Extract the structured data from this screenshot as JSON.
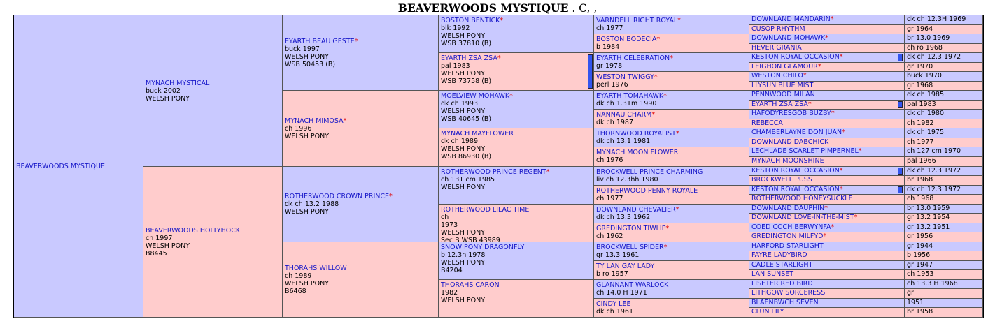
{
  "title": {
    "name": "BEAVERWOODS MYSTIQUE",
    "suffix": " . C, ,"
  },
  "subject": {
    "name": "BEAVERWOODS MYSTIQUE"
  },
  "gen1": [
    {
      "sex": "m",
      "name": "MYNACH MYSTICAL",
      "star": "",
      "lines": [
        "buck 2002",
        "WELSH PONY"
      ]
    },
    {
      "sex": "f",
      "name": "BEAVERWOODS HOLLYHOCK",
      "star": "",
      "lines": [
        "ch 1997",
        "WELSH PONY",
        "B8445"
      ]
    }
  ],
  "gen2": [
    {
      "sex": "m",
      "name": "EYARTH BEAU GESTE",
      "star": "*",
      "lines": [
        "buck 1997",
        "WELSH PONY",
        "WSB 50453 (B)"
      ]
    },
    {
      "sex": "f",
      "name": "MYNACH MIMOSA",
      "star": "*",
      "lines": [
        "ch 1996",
        "WELSH PONY"
      ]
    },
    {
      "sex": "m",
      "name": "ROTHERWOOD CROWN PRINCE",
      "star": "*",
      "lines": [
        "dk ch 13.2 1988",
        "WELSH PONY"
      ]
    },
    {
      "sex": "f",
      "name": "THORAHS WILLOW",
      "star": "",
      "lines": [
        "ch 1989",
        "WELSH PONY",
        "B6468"
      ]
    }
  ],
  "gen3": [
    {
      "sex": "m",
      "name": "BOSTON BENTICK",
      "star": "*",
      "lines": [
        "blk 1992",
        "WELSH PONY",
        "WSB 37810 (B)"
      ]
    },
    {
      "sex": "f",
      "name": "EYARTH ZSA ZSA",
      "star": "*",
      "lines": [
        "pal 1983",
        "WELSH PONY",
        "WSB 73758 (B)"
      ]
    },
    {
      "sex": "m",
      "name": "MOELVIEW MOHAWK",
      "star": "*",
      "lines": [
        "dk ch 1993",
        "WELSH PONY",
        "WSB 40645 (B)"
      ]
    },
    {
      "sex": "f",
      "name": "MYNACH MAYFLOWER",
      "star": "",
      "lines": [
        "dk ch 1989",
        "WELSH PONY",
        "WSB 86930 (B)"
      ]
    },
    {
      "sex": "m",
      "name": "ROTHERWOOD PRINCE REGENT",
      "star": "*",
      "lines": [
        "ch 131 cm 1985",
        "WELSH PONY"
      ]
    },
    {
      "sex": "f",
      "name": "ROTHERWOOD LILAC TIME",
      "star": "",
      "lines": [
        "ch",
        "1973",
        "WELSH PONY",
        "Sec B WSB 43989"
      ]
    },
    {
      "sex": "m",
      "name": "SNOW PONY DRAGONFLY",
      "star": "",
      "lines": [
        "b 12.3h 1978",
        "WELSH PONY",
        "B4204"
      ]
    },
    {
      "sex": "f",
      "name": "THORAHS CARON",
      "star": "",
      "lines": [
        "1982",
        "WELSH PONY"
      ]
    }
  ],
  "gen4": [
    {
      "sex": "m",
      "name": "VARNDELL RIGHT ROYAL",
      "star": "*",
      "lines": [
        "ch 1977"
      ]
    },
    {
      "sex": "f",
      "name": "BOSTON BODECIA",
      "star": "*",
      "lines": [
        "b 1984"
      ]
    },
    {
      "sex": "m",
      "name": "EYARTH CELEBRATION",
      "star": "*",
      "lines": [
        "gr 1978"
      ]
    },
    {
      "sex": "f",
      "name": "WESTON TWIGGY",
      "star": "*",
      "lines": [
        "perl 1976"
      ]
    },
    {
      "sex": "m",
      "name": "EYARTH TOMAHAWK",
      "star": "*",
      "lines": [
        "dk ch 1.31m 1990"
      ]
    },
    {
      "sex": "f",
      "name": "NANNAU CHARM",
      "star": "*",
      "lines": [
        "dk ch 1987"
      ]
    },
    {
      "sex": "m",
      "name": "THORNWOOD ROYALIST",
      "star": "*",
      "lines": [
        "dk ch 13.1 1981"
      ]
    },
    {
      "sex": "f",
      "name": "MYNACH MOON FLOWER",
      "star": "",
      "lines": [
        "ch 1976"
      ]
    },
    {
      "sex": "m",
      "name": "BROCKWELL PRINCE CHARMING",
      "star": "",
      "lines": [
        "liv ch 12.3hh 1980"
      ]
    },
    {
      "sex": "f",
      "name": "ROTHERWOOD PENNY ROYALE",
      "star": "",
      "lines": [
        "ch 1977"
      ]
    },
    {
      "sex": "m",
      "name": "DOWNLAND CHEVALIER",
      "star": "*",
      "lines": [
        "dk ch 13.3 1962"
      ]
    },
    {
      "sex": "f",
      "name": "GREDINGTON TIWLIP",
      "star": "*",
      "lines": [
        "ch 1962"
      ]
    },
    {
      "sex": "m",
      "name": "BROCKWELL SPIDER",
      "star": "*",
      "lines": [
        "gr 13.3 1961"
      ]
    },
    {
      "sex": "f",
      "name": "TY LAN GAY LADY",
      "star": "",
      "lines": [
        "b ro 1957"
      ]
    },
    {
      "sex": "m",
      "name": "GLANNANT WARLOCK",
      "star": "",
      "lines": [
        "ch 14.0 H 1971"
      ]
    },
    {
      "sex": "f",
      "name": "CINDY LEE",
      "star": "",
      "lines": [
        "dk ch 1961"
      ]
    }
  ],
  "gen5": [
    {
      "sex": "m",
      "name": "DOWNLAND MANDARIN",
      "star": "*",
      "info": "dk ch 12.3H 1969"
    },
    {
      "sex": "f",
      "name": "CUSOP RHYTHM",
      "star": "",
      "info": "gr 1964"
    },
    {
      "sex": "m",
      "name": "DOWNLAND MOHAWK",
      "star": "*",
      "info": "br 13.0 1969"
    },
    {
      "sex": "f",
      "name": "HEVER GRANIA",
      "star": "",
      "info": "ch ro 1968"
    },
    {
      "sex": "m",
      "name": "KESTON ROYAL OCCASION",
      "star": "*",
      "info": "dk ch 12.3 1972"
    },
    {
      "sex": "f",
      "name": "LEIGHON GLAMOUR",
      "star": "*",
      "info": "gr 1970"
    },
    {
      "sex": "m",
      "name": "WESTON CHILO",
      "star": "*",
      "info": "buck 1970"
    },
    {
      "sex": "f",
      "name": "LLYSUN BLUE MIST",
      "star": "",
      "info": "gr 1968"
    },
    {
      "sex": "m",
      "name": "PENNWOOD MILAN",
      "star": "",
      "info": "dk ch 1985"
    },
    {
      "sex": "f",
      "name": "EYARTH ZSA ZSA",
      "star": "*",
      "info": "pal 1983"
    },
    {
      "sex": "m",
      "name": "HAFODYRESGOB BUZBY",
      "star": "*",
      "info": "dk ch 1980"
    },
    {
      "sex": "f",
      "name": "REBECCA",
      "star": "",
      "info": "ch 1982"
    },
    {
      "sex": "m",
      "name": "CHAMBERLAYNE DON JUAN",
      "star": "*",
      "info": "dk ch 1975"
    },
    {
      "sex": "f",
      "name": "DOWNLAND DABCHICK",
      "star": "",
      "info": "ch 1977"
    },
    {
      "sex": "m",
      "name": "LECHLADE SCARLET PIMPERNEL",
      "star": "*",
      "info": "ch 127 cm 1970"
    },
    {
      "sex": "f",
      "name": "MYNACH MOONSHINE",
      "star": "",
      "info": "pal 1966"
    },
    {
      "sex": "m",
      "name": "KESTON ROYAL OCCASION",
      "star": "*",
      "info": "dk ch 12.3 1972"
    },
    {
      "sex": "f",
      "name": "BROCKWELL PUSS",
      "star": "",
      "info": "br 1968"
    },
    {
      "sex": "m",
      "name": "KESTON ROYAL OCCASION",
      "star": "*",
      "info": "dk ch 12.3 1972"
    },
    {
      "sex": "f",
      "name": "ROTHERWOOD HONEYSUCKLE",
      "star": "",
      "info": "ch 1968"
    },
    {
      "sex": "m",
      "name": "DOWNLAND DAUPHIN",
      "star": "*",
      "info": "br 13.0 1959"
    },
    {
      "sex": "f",
      "name": "DOWNLAND LOVE-IN-THE-MIST",
      "star": "*",
      "info": "gr 13.2 1954"
    },
    {
      "sex": "m",
      "name": "COED COCH BERWYNFA",
      "star": "*",
      "info": "gr 13.2 1951"
    },
    {
      "sex": "f",
      "name": "GREDINGTON MILFYD",
      "star": "*",
      "info": "gr 1956"
    },
    {
      "sex": "m",
      "name": "HARFORD STARLIGHT",
      "star": "",
      "info": "gr 1944"
    },
    {
      "sex": "f",
      "name": "FAYRE LADYBIRD",
      "star": "",
      "info": "b 1956"
    },
    {
      "sex": "m",
      "name": "CADLE STARLIGHT",
      "star": "",
      "info": "gr 1947"
    },
    {
      "sex": "f",
      "name": "LAN SUNSET",
      "star": "",
      "info": "ch 1953"
    },
    {
      "sex": "m",
      "name": "LISETER RED BIRD",
      "star": "",
      "info": "ch 13.3 H 1968"
    },
    {
      "sex": "f",
      "name": "LITHGOW SORCERESS",
      "star": "",
      "info": "gr"
    },
    {
      "sex": "m",
      "name": "BLAENBWCH SEVEN",
      "star": "",
      "info": "1951"
    },
    {
      "sex": "f",
      "name": "CLUN LILY",
      "star": "",
      "info": "br 1958"
    }
  ],
  "colors": {
    "male": "#c9c9ff",
    "female": "#ffcccc",
    "name": "#1515c8",
    "star": "#e00000",
    "inbreeding_marker": "#3355ee"
  },
  "inbreeding_markers": {
    "gen3": [
      1
    ],
    "gen5": [
      4,
      9,
      16,
      18
    ]
  }
}
